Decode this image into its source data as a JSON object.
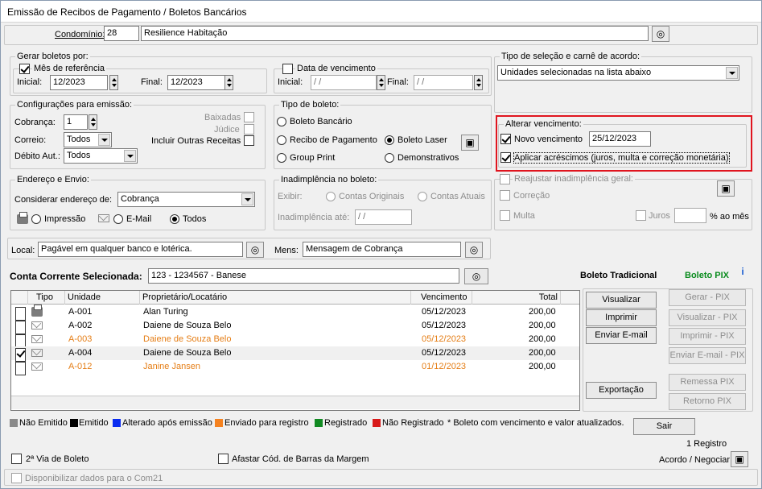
{
  "title": "Emissão de Recibos de Pagamento / Boletos Bancários",
  "condominio": {
    "label": "Condomínio:",
    "code": "28",
    "name": "Resilience Habitação"
  },
  "gerar": {
    "legend": "Gerar boletos por:",
    "mes_ref": "Mês de referência",
    "data_venc": "Data de vencimento",
    "inicial_label": "Inicial:",
    "final_label": "Final:",
    "inicial": "12/2023",
    "final": "12/2023",
    "venc_inicial": " /  /",
    "venc_final": " /  /"
  },
  "tipo_selecao": {
    "legend": "Tipo de seleção e carnê de acordo:",
    "value": "Unidades selecionadas na lista abaixo"
  },
  "config": {
    "legend": "Configurações para emissão:",
    "cobranca_label": "Cobrança:",
    "cobranca": "1",
    "correio_label": "Correio:",
    "correio": "Todos",
    "debito_label": "Débito Aut.:",
    "debito": "Todos",
    "baixadas": "Baixadas",
    "judice": "Júdice",
    "incluir": "Incluir Outras Receitas"
  },
  "tipo_boleto": {
    "legend": "Tipo de boleto:",
    "bancario": "Boleto Bancário",
    "recibo": "Recibo de Pagamento",
    "laser": "Boleto Laser",
    "group": "Group Print",
    "demonstrativos": "Demonstrativos"
  },
  "alterar": {
    "legend": "Alterar vencimento:",
    "novo_label": "Novo vencimento",
    "novo_value": "25/12/2023",
    "aplicar": "Aplicar acréscimos (juros, multa e correção monetária)"
  },
  "reajustar": {
    "label": "Reajustar inadimplência geral:",
    "correcao": "Correção",
    "multa": "Multa",
    "juros": "Juros",
    "ao_mes": "% ao mês"
  },
  "endereco": {
    "legend": "Endereço e Envio:",
    "considerar_label": "Considerar endereço de:",
    "considerar": "Cobrança",
    "impressao": "Impressão",
    "email": "E-Mail",
    "todos": "Todos"
  },
  "inadimplencia": {
    "legend": "Inadimplência no boleto:",
    "exibir": "Exibir:",
    "originais": "Contas Originais",
    "atuais": "Contas Atuais",
    "ate_label": "Inadimplência até:",
    "ate": " /  /"
  },
  "local": {
    "label": "Local:",
    "value": "Pagável em qualquer banco e lotérica."
  },
  "mens": {
    "label": "Mens:",
    "value": "Mensagem de Cobrança"
  },
  "conta": {
    "label": "Conta Corrente Selecionada:",
    "value": "123 - 1234567 - Banese"
  },
  "boleto_tradicional": "Boleto Tradicional",
  "boleto_pix": "Boleto PIX",
  "grid": {
    "headers": [
      "Tipo",
      "Unidade",
      "Proprietário/Locatário",
      "Vencimento",
      "Total"
    ],
    "rows": [
      {
        "unidade": "A-001",
        "nome": "Alan Turing",
        "venc": "05/12/2023",
        "total": "200,00"
      },
      {
        "unidade": "A-002",
        "nome": "Daiene de Souza Belo",
        "venc": "05/12/2023",
        "total": "200,00"
      },
      {
        "unidade": "A-003",
        "nome": "Daiene de Souza Belo",
        "venc": "05/12/2023",
        "total": "200,00"
      },
      {
        "unidade": "A-004",
        "nome": "Daiene de Souza Belo",
        "venc": "05/12/2023",
        "total": "200,00"
      },
      {
        "unidade": "A-012",
        "nome": "Janine Jansen",
        "venc": "01/12/2023",
        "total": "200,00"
      }
    ]
  },
  "buttons": {
    "visualizar": "Visualizar",
    "imprimir": "Imprimir",
    "enviar_email": "Enviar E-mail",
    "exportacao": "Exportação",
    "gerar_pix": "Gerar - PIX",
    "visualizar_pix": "Visualizar - PIX",
    "imprimir_pix": "Imprimir - PIX",
    "enviar_pix": "Enviar E-mail - PIX",
    "remessa_pix": "Remessa PIX",
    "retorno_pix": "Retorno PIX",
    "sair": "Sair"
  },
  "legend": {
    "nao_emitido": "Não Emitido",
    "emitido": "Emitido",
    "alterado": "Alterado após emissão",
    "enviado": "Enviado para registro",
    "registrado": "Registrado",
    "nao_registrado": "Não Registrado",
    "nota": "* Boleto com vencimento e valor atualizados."
  },
  "registro_count": "1 Registro",
  "segunda_via": "2ª Via de Boleto",
  "afastar": "Afastar Cód. de Barras da Margem",
  "acordo": "Acordo / Negociar",
  "disponibilizar": "Disponibilizar dados para o Com21",
  "colors": {
    "orange": "#e57e16",
    "green": "#0a8c1e",
    "red_highlight": "#e0141e"
  }
}
